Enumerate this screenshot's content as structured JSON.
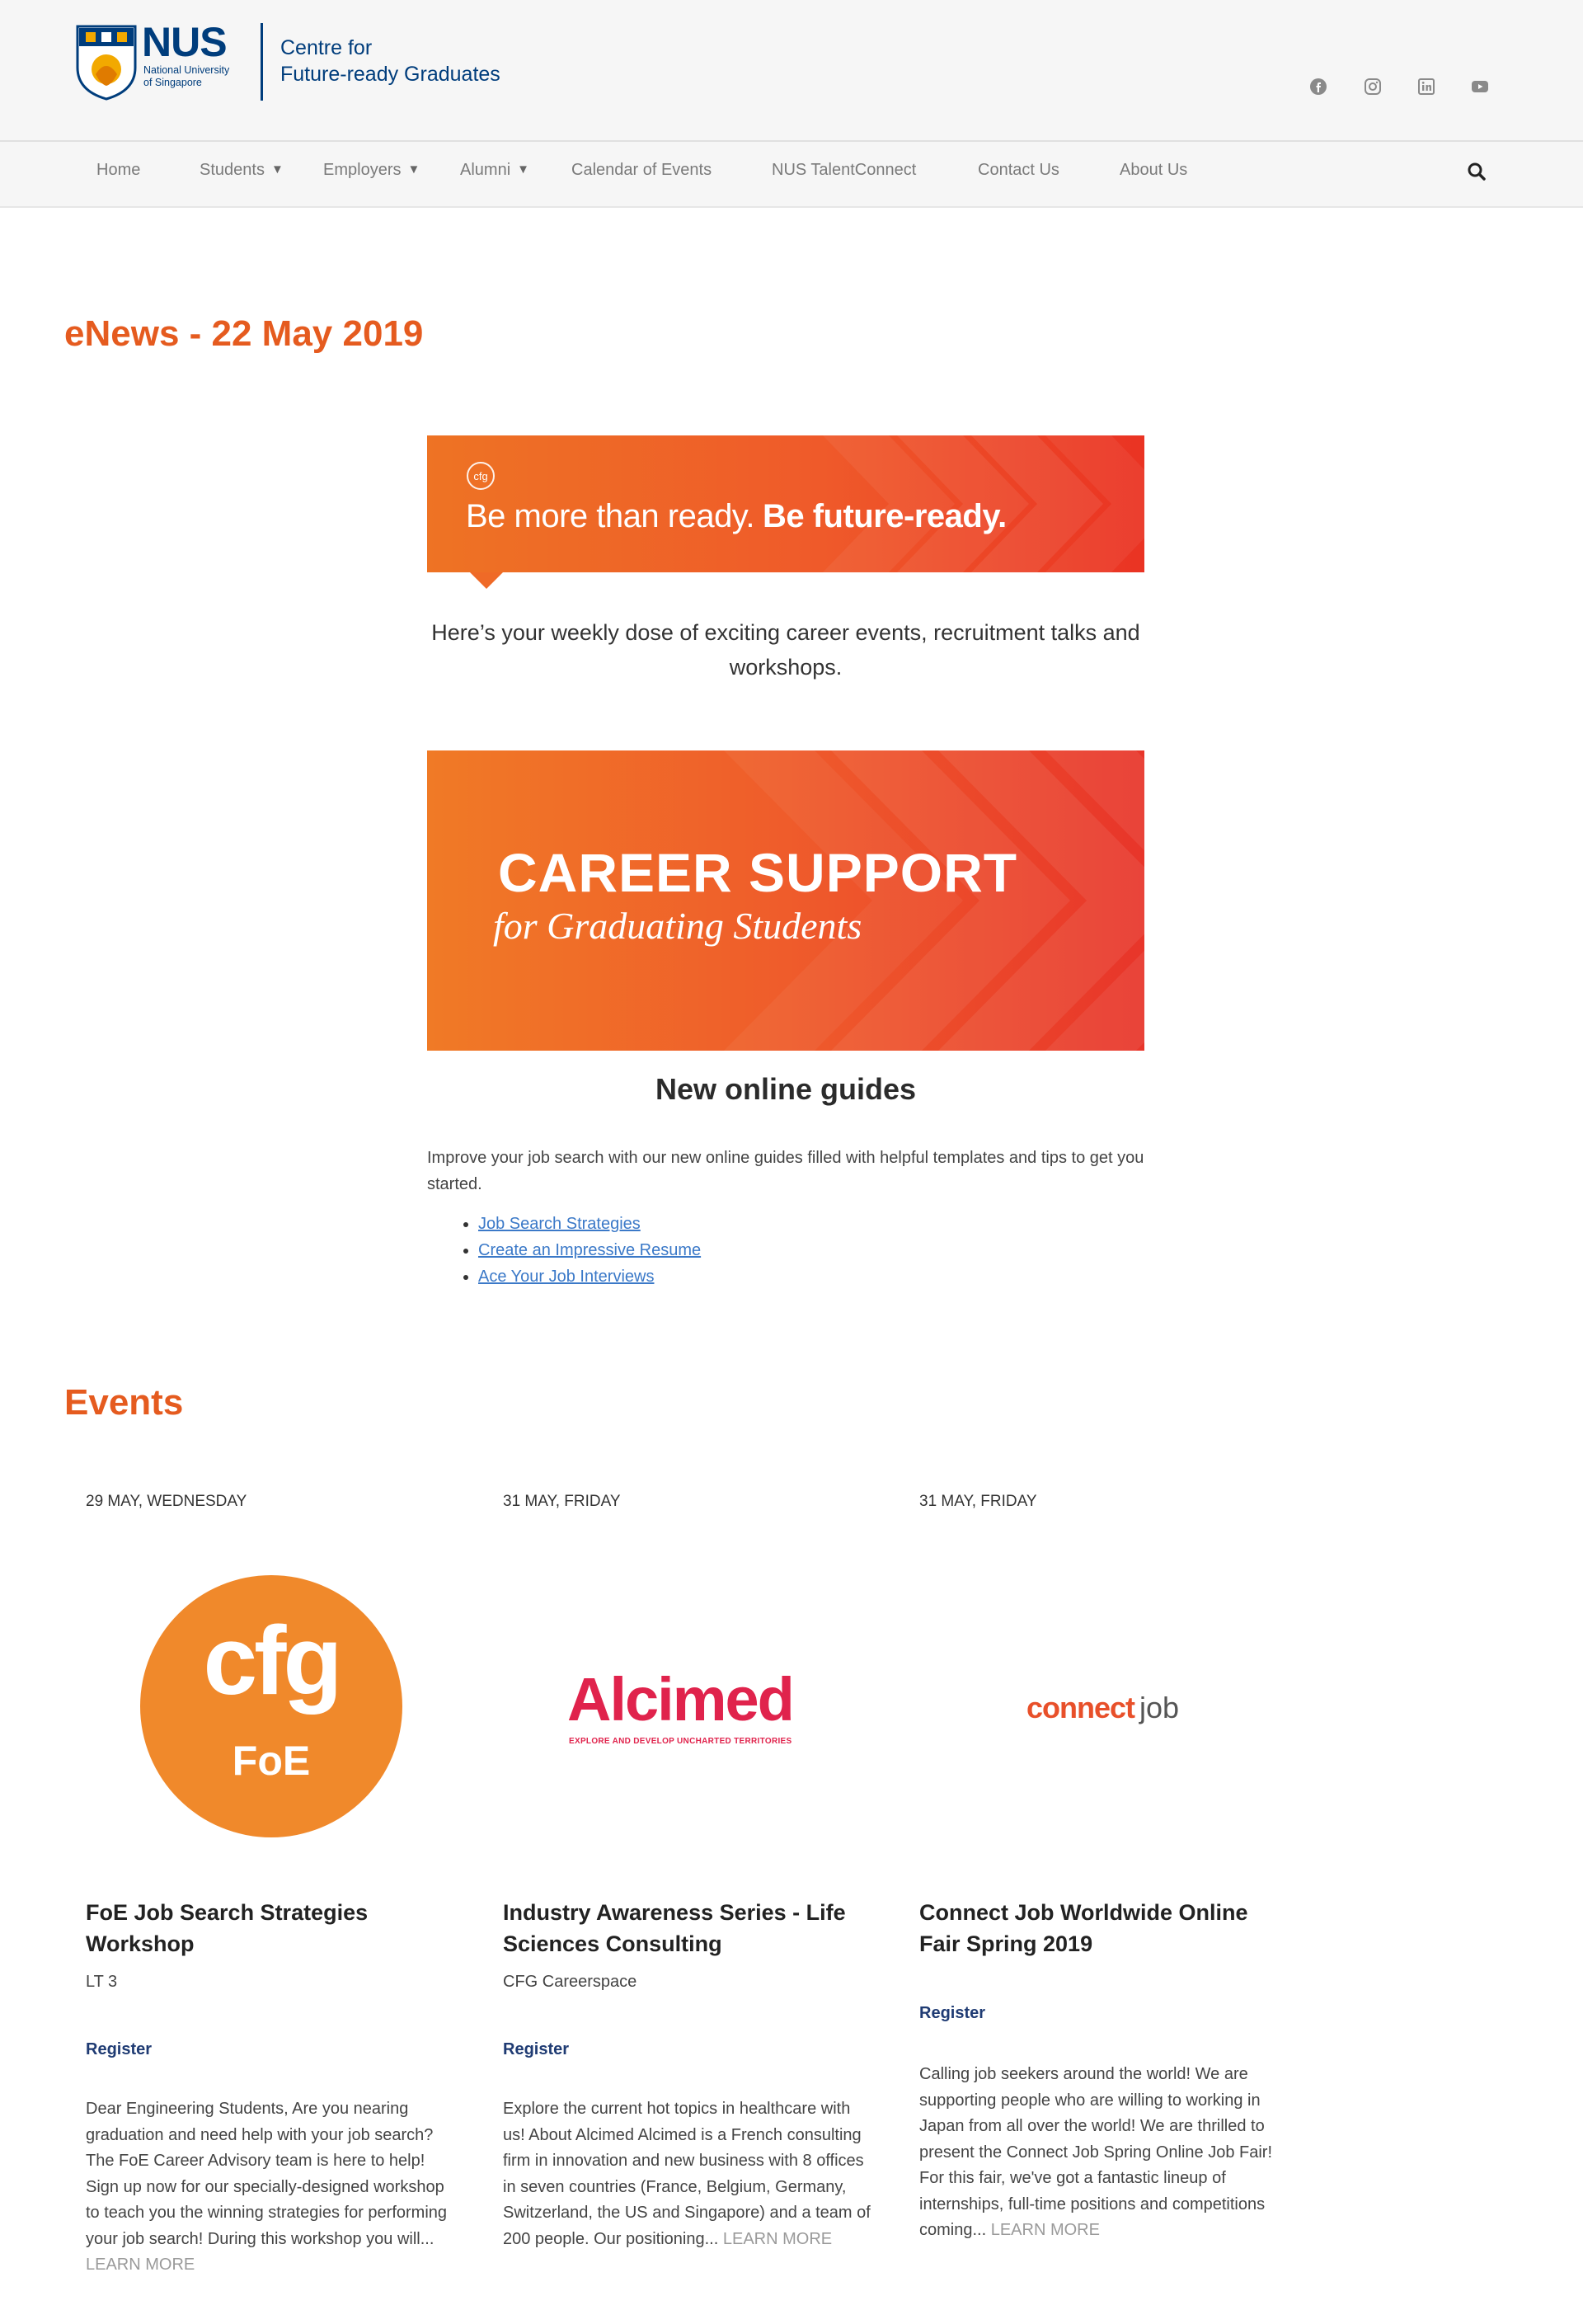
{
  "header": {
    "nus_wordmark": "NUS",
    "nus_subtitle_1": "National University",
    "nus_subtitle_2": "of Singapore",
    "centre_line_1": "Centre for",
    "centre_line_2": "Future-ready Graduates",
    "social": [
      "facebook-icon",
      "instagram-icon",
      "linkedin-icon",
      "youtube-icon"
    ]
  },
  "nav": {
    "items": [
      {
        "label": "Home"
      },
      {
        "label": "Students",
        "dropdown": true
      },
      {
        "label": "Employers",
        "dropdown": true
      },
      {
        "label": "Alumni",
        "dropdown": true
      },
      {
        "label": "Calendar of Events"
      },
      {
        "label": "NUS TalentConnect"
      },
      {
        "label": "Contact Us"
      },
      {
        "label": "About Us"
      }
    ],
    "caret": "▼",
    "search_icon": "search-icon"
  },
  "page": {
    "title": "eNews - 22 May 2019"
  },
  "banner1": {
    "badge": "cfg",
    "tagline_regular": "Be more than ready.",
    "tagline_bold": "Be future-ready."
  },
  "intro": {
    "text": "Here’s your weekly dose of exciting career events, recruitment talks and workshops."
  },
  "banner2": {
    "title": "CAREER SUPPORT",
    "subtitle": "for Graduating Students"
  },
  "guides": {
    "heading": "New online guides",
    "description": "Improve your job search with our new online guides filled with helpful templates and tips to get you started.",
    "links": [
      {
        "label": "Job Search Strategies"
      },
      {
        "label": "Create an Impressive Resume"
      },
      {
        "label": "Ace Your Job Interviews"
      }
    ]
  },
  "events": {
    "heading": "Events",
    "items": [
      {
        "date": "29 MAY, WEDNESDAY",
        "logo_main": "cfg",
        "logo_sub": "FoE",
        "title": "FoE Job Search Strategies Workshop",
        "location": "LT 3",
        "register": "Register",
        "description": "Dear Engineering Students,  Are you nearing graduation and need help with your job search? The FoE Career Advisory team is here to help! Sign up now for our specially-designed workshop to teach you the winning strategies for performing your job search! During this workshop you will...",
        "learn_more": "LEARN MORE"
      },
      {
        "date": "31 MAY, FRIDAY",
        "logo_main": "Alcimed",
        "logo_sub": "EXPLORE AND DEVELOP UNCHARTED TERRITORIES",
        "title": "Industry Awareness Series - Life Sciences Consulting",
        "location": "CFG Careerspace",
        "register": "Register",
        "description": "Explore the current hot topics in healthcare with us!  About Alcimed  Alcimed is a French consulting firm in innovation and new business with 8 offices in seven countries (France, Belgium, Germany, Switzerland, the US and Singapore) and a team of 200 people.  Our positioning...",
        "learn_more": "LEARN MORE"
      },
      {
        "date": "31 MAY, FRIDAY",
        "logo_main": "connect",
        "logo_sub": "job",
        "title": "Connect Job Worldwide Online Fair Spring 2019",
        "location": "",
        "register": "Register",
        "description": "Calling job seekers around the world! We are supporting people who are willing to working in Japan from all over the world! We are thrilled to present the Connect Job Spring Online Job Fair! For this fair, we've got a fantastic lineup of internships, full-time positions and competitions coming...",
        "learn_more": "LEARN MORE"
      }
    ]
  },
  "colors": {
    "accent_orange": "#e55b1f",
    "nus_blue": "#003d7c",
    "link_blue": "#3b79c8",
    "register_navy": "#1f3b73",
    "alcimed_red": "#e0234c"
  }
}
